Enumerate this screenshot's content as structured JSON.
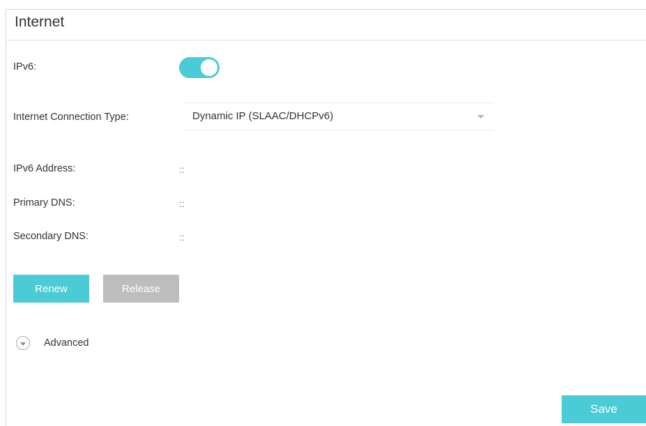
{
  "panel": {
    "title": "Internet"
  },
  "ipv6": {
    "label": "IPv6:",
    "enabled": true
  },
  "connection_type": {
    "label": "Internet Connection Type:",
    "selected": "Dynamic IP (SLAAC/DHCPv6)"
  },
  "ipv6_address": {
    "label": "IPv6 Address:",
    "value": "::"
  },
  "primary_dns": {
    "label": "Primary DNS:",
    "value": "::"
  },
  "secondary_dns": {
    "label": "Secondary DNS:",
    "value": "::"
  },
  "buttons": {
    "renew": "Renew",
    "release": "Release",
    "save": "Save"
  },
  "advanced": {
    "label": "Advanced",
    "icon": "chevron-down-circle-icon"
  },
  "colors": {
    "accent": "#4acbd6",
    "disabled": "#bdbdbd"
  }
}
